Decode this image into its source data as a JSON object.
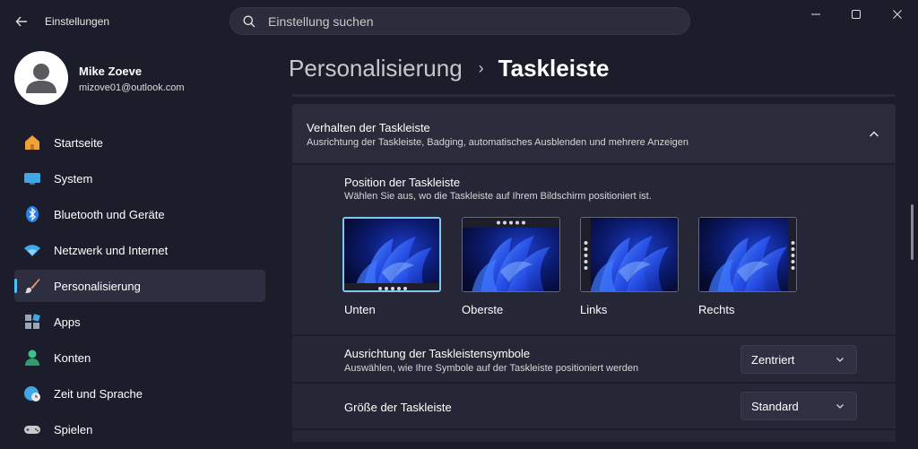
{
  "window": {
    "title": "Einstellungen",
    "controls": {
      "minimize": "minimize-icon",
      "maximize": "maximize-icon",
      "close": "close-icon"
    }
  },
  "search": {
    "placeholder": "Einstellung suchen",
    "value": ""
  },
  "user": {
    "name": "Mike Zoeve",
    "email": "mizove01@outlook.com"
  },
  "sidebar": {
    "items": [
      {
        "label": "Startseite",
        "icon": "home-icon"
      },
      {
        "label": "System",
        "icon": "system-icon"
      },
      {
        "label": "Bluetooth und Geräte",
        "icon": "bluetooth-icon"
      },
      {
        "label": "Netzwerk und Internet",
        "icon": "wifi-icon"
      },
      {
        "label": "Personalisierung",
        "icon": "brush-icon",
        "active": true
      },
      {
        "label": "Apps",
        "icon": "apps-icon"
      },
      {
        "label": "Konten",
        "icon": "person-icon"
      },
      {
        "label": "Zeit und Sprache",
        "icon": "clock-globe-icon"
      },
      {
        "label": "Spielen",
        "icon": "gamepad-icon"
      }
    ]
  },
  "breadcrumb": {
    "parent": "Personalisierung",
    "separator": "›",
    "current": "Taskleiste"
  },
  "behavior": {
    "title": "Verhalten der Taskleiste",
    "subtitle": "Ausrichtung der Taskleiste, Badging, automatisches Ausblenden und mehrere Anzeigen",
    "expanded": true
  },
  "position": {
    "title": "Position der Taskleiste",
    "subtitle": "Wählen Sie aus, wo die Taskleiste auf Ihrem Bildschirm positioniert ist.",
    "options": [
      {
        "label": "Unten",
        "selected": true
      },
      {
        "label": "Oberste",
        "selected": false
      },
      {
        "label": "Links",
        "selected": false
      },
      {
        "label": "Rechts",
        "selected": false
      }
    ]
  },
  "alignment": {
    "title": "Ausrichtung der Taskleistensymbole",
    "subtitle": "Auswählen, wie Ihre Symbole auf der Taskleiste positioniert werden",
    "value": "Zentriert"
  },
  "size": {
    "title": "Größe der Taskleiste",
    "value": "Standard"
  },
  "colors": {
    "accent": "#4cc2ff",
    "background": "#1c1d2b",
    "card": "#2b2c3b"
  }
}
